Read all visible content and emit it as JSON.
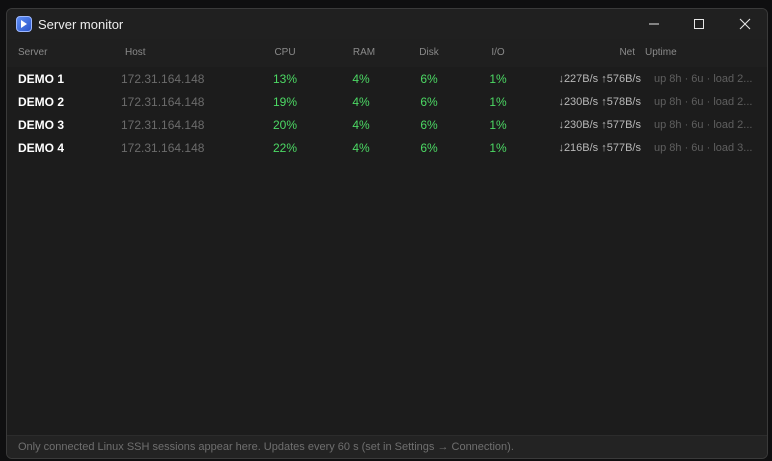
{
  "window": {
    "title": "Server monitor",
    "icon": "terminal-app-icon"
  },
  "controls": {
    "minimize_icon": "minimize-icon",
    "maximize_icon": "maximize-icon",
    "close_icon": "close-icon"
  },
  "table": {
    "headers": {
      "server": "Server",
      "host": "Host",
      "cpu": "CPU",
      "ram": "RAM",
      "disk": "Disk",
      "io": "I/O",
      "net": "Net",
      "uptime": "Uptime"
    },
    "rows": [
      {
        "server": "DEMO 1",
        "host": "172.31.164.148",
        "cpu": "13%",
        "ram": "4%",
        "disk": "6%",
        "io": "1%",
        "net": "↓227B/s ↑576B/s",
        "uptime": "up 8h · 6u · load 2..."
      },
      {
        "server": "DEMO 2",
        "host": "172.31.164.148",
        "cpu": "19%",
        "ram": "4%",
        "disk": "6%",
        "io": "1%",
        "net": "↓230B/s ↑578B/s",
        "uptime": "up 8h · 6u · load 2..."
      },
      {
        "server": "DEMO 3",
        "host": "172.31.164.148",
        "cpu": "20%",
        "ram": "4%",
        "disk": "6%",
        "io": "1%",
        "net": "↓230B/s ↑577B/s",
        "uptime": "up 8h · 6u · load 2..."
      },
      {
        "server": "DEMO 4",
        "host": "172.31.164.148",
        "cpu": "22%",
        "ram": "4%",
        "disk": "6%",
        "io": "1%",
        "net": "↓216B/s ↑577B/s",
        "uptime": "up 8h · 6u · load 3..."
      }
    ]
  },
  "footer": {
    "text": "Only connected Linux SSH sessions appear here. Updates every 60 s (set in Settings → Connection)."
  },
  "colors": {
    "good": "#4cd964",
    "background": "#1c1c1c"
  }
}
